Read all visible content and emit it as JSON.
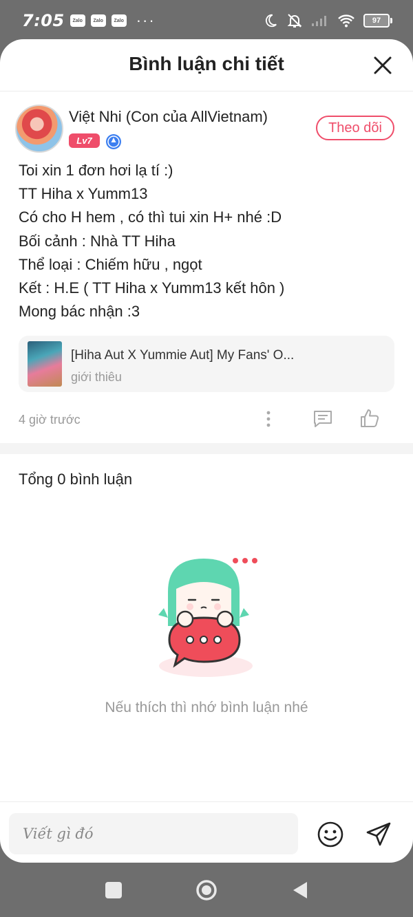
{
  "status_bar": {
    "time": "7:05",
    "notification_apps": [
      "Zalo",
      "Zalo",
      "Zalo"
    ],
    "more": "···",
    "battery": "97"
  },
  "header": {
    "title": "Bình luận chi tiết"
  },
  "post": {
    "author_name": "Việt Nhi (Con của AllVietnam)",
    "level": "Lv7",
    "follow_label": "Theo dõi",
    "lines": [
      "Toi xin 1 đơn hơi lạ tí :)",
      "TT Hiha x Yumm13",
      "Có cho H hem , có thì tui xin H+ nhé :D",
      "Bối cảnh : Nhà TT Hiha",
      "Thể loại : Chiếm hữu , ngọt",
      "Kết : H.E ( TT Hiha x Yumm13 kết hôn )",
      "Mong bác nhận :3"
    ],
    "work_title": "[Hiha Aut X Yummie Aut] My Fans' O...",
    "work_subtitle": "giới thiêu",
    "time": "4 giờ trước"
  },
  "comments": {
    "total_label": "Tổng 0 bình luận",
    "empty_text": "Nếu thích thì nhớ bình luận nhé"
  },
  "composer": {
    "placeholder": "Viết gì đó"
  },
  "colors": {
    "accent": "#ef4d6a",
    "mascot_hair": "#5ed6b0",
    "bubble": "#ef4d5a"
  }
}
